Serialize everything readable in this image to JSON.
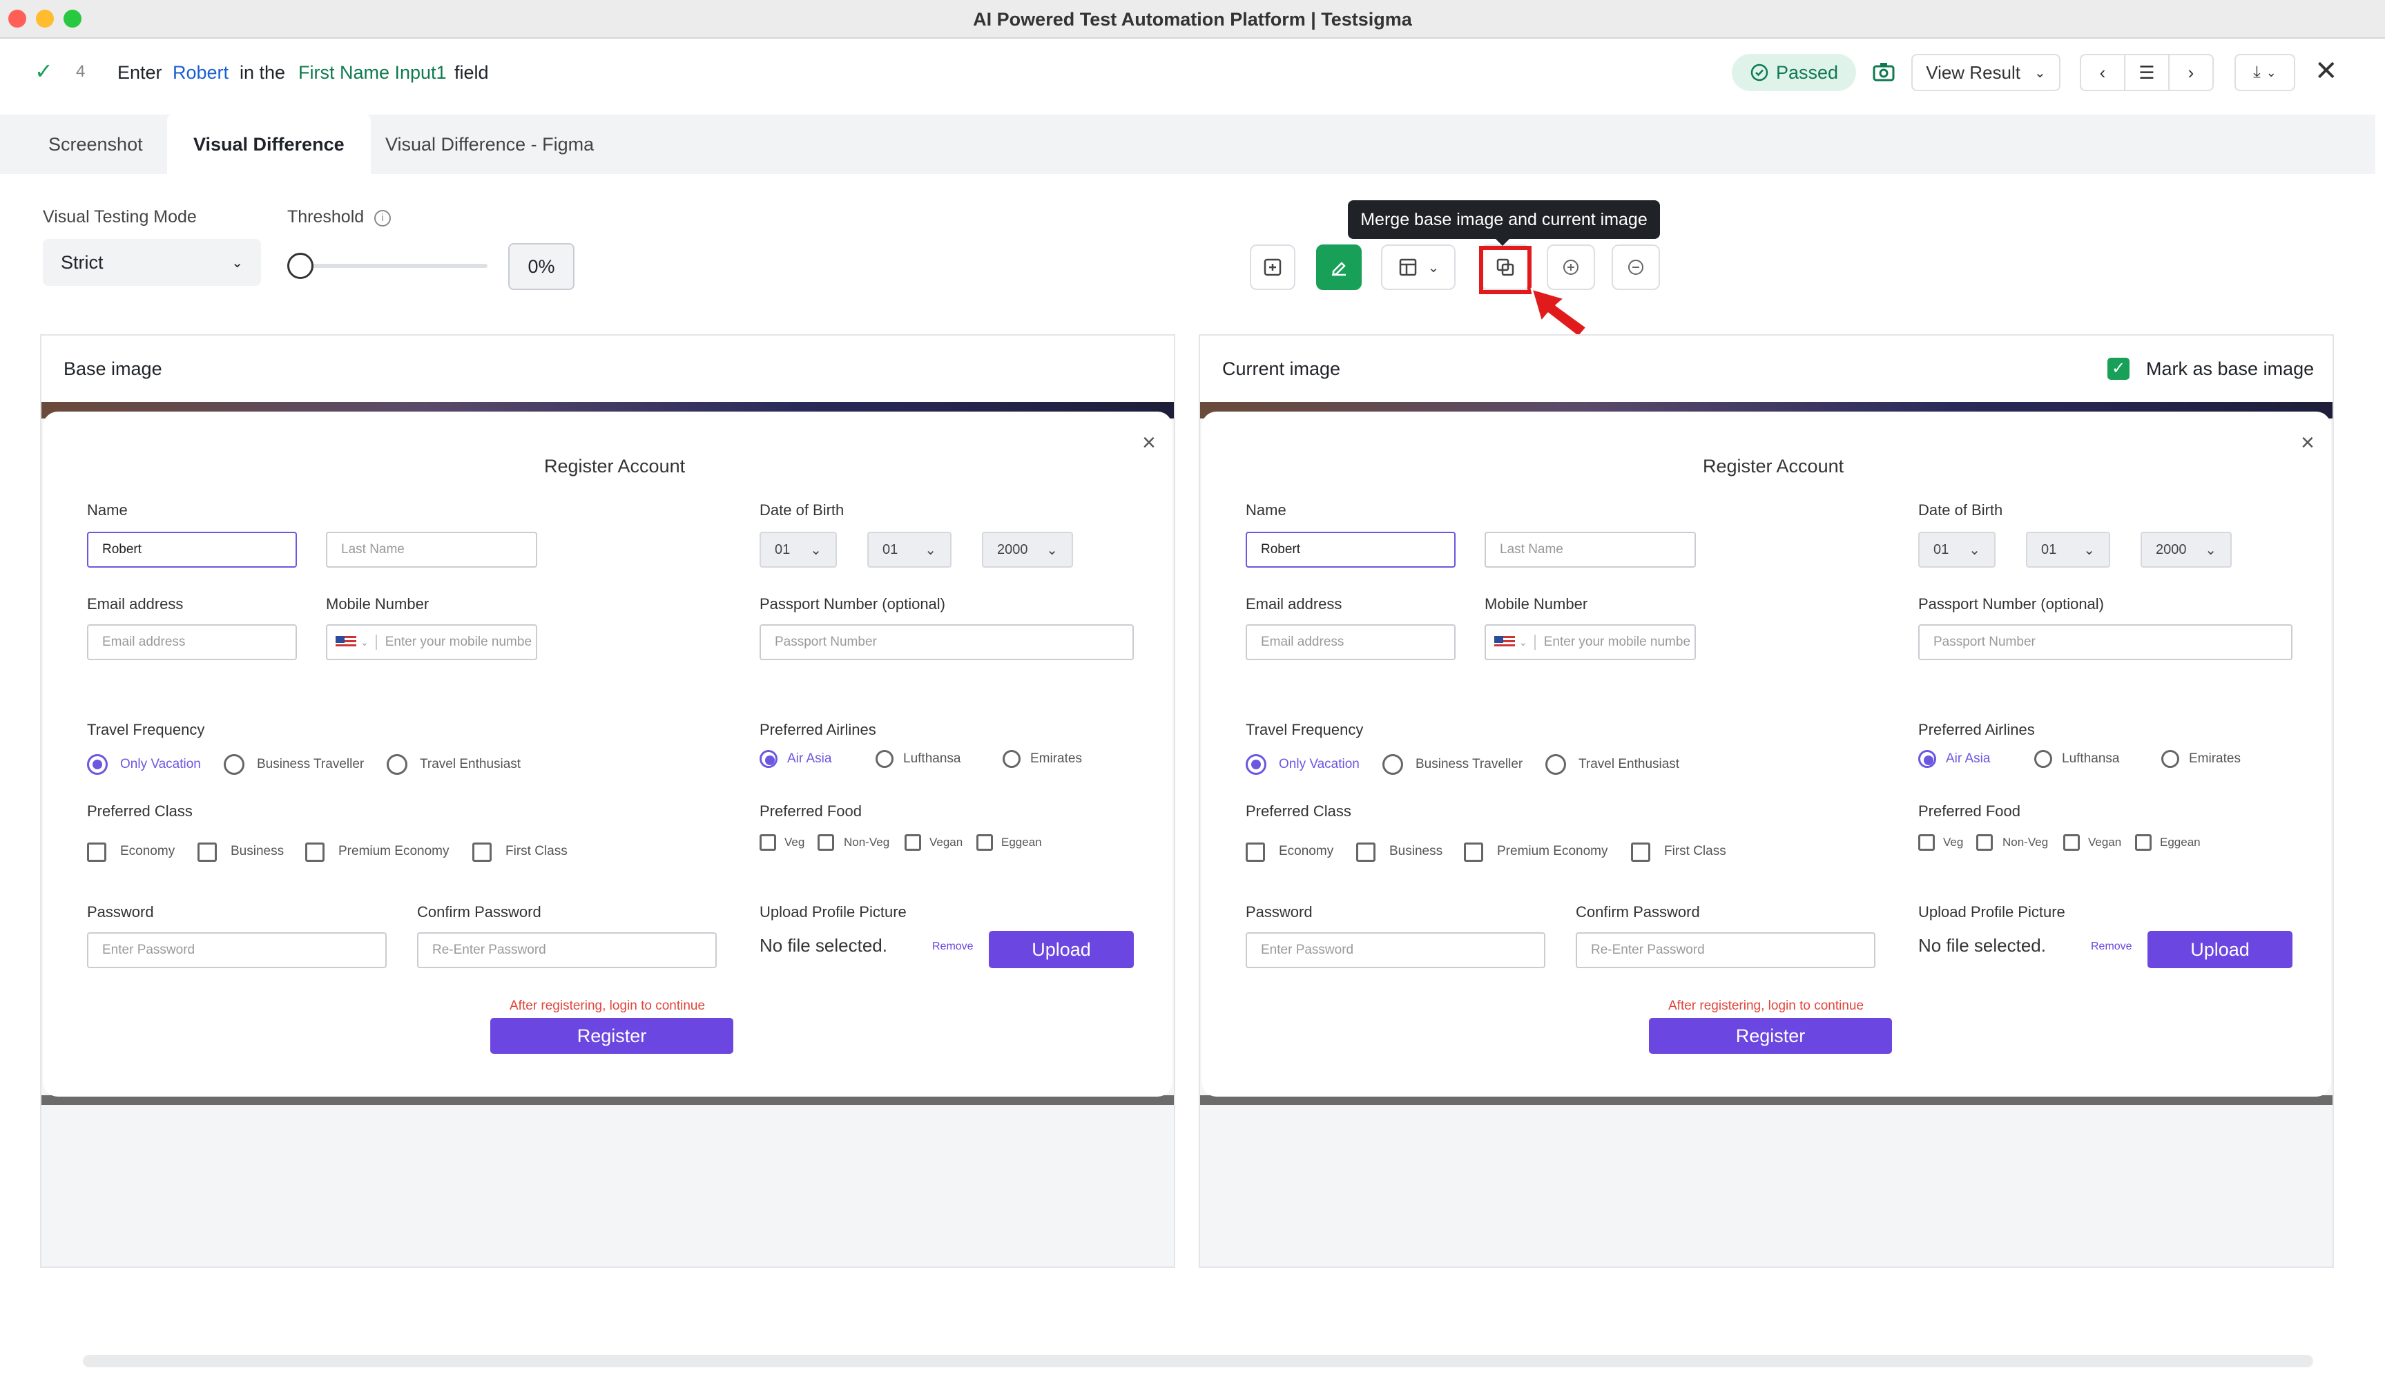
{
  "window": {
    "title": "AI Powered Test Automation Platform | Testsigma"
  },
  "step": {
    "number": "4",
    "parts": [
      "Enter",
      "Robert",
      "in the",
      "First Name Input1",
      "field"
    ],
    "status": "Passed",
    "view_result": "View Result"
  },
  "tabs": [
    "Screenshot",
    "Visual Difference",
    "Visual Difference - Figma"
  ],
  "controls": {
    "mode_label": "Visual Testing Mode",
    "mode_value": "Strict",
    "threshold_label": "Threshold",
    "threshold_value": "0%",
    "threshold_level": 0
  },
  "toolbar": {
    "tooltip": "Merge base image and current image"
  },
  "panels": {
    "base_title": "Base image",
    "current_title": "Current image",
    "mark_base": "Mark as base image"
  },
  "form": {
    "title": "Register Account",
    "name_label": "Name",
    "first_name_value": "Robert",
    "last_name_placeholder": "Last Name",
    "dob_label": "Date of Birth",
    "dob_day": "01",
    "dob_month": "01",
    "dob_year": "2000",
    "email_label": "Email address",
    "email_placeholder": "Email address",
    "mobile_label": "Mobile Number",
    "mobile_placeholder": "Enter your mobile numbe",
    "passport_label": "Passport Number (optional)",
    "passport_placeholder": "Passport Number",
    "travel_label": "Travel Frequency",
    "travel_options": [
      "Only Vacation",
      "Business Traveller",
      "Travel Enthusiast"
    ],
    "airlines_label": "Preferred Airlines",
    "airline_options": [
      "Air Asia",
      "Lufthansa",
      "Emirates"
    ],
    "class_label": "Preferred Class",
    "class_options": [
      "Economy",
      "Business",
      "Premium Economy",
      "First Class"
    ],
    "food_label": "Preferred Food",
    "food_options": [
      "Veg",
      "Non-Veg",
      "Vegan",
      "Eggean"
    ],
    "password_label": "Password",
    "password_placeholder": "Enter Password",
    "confirm_label": "Confirm Password",
    "confirm_placeholder": "Re-Enter Password",
    "upload_label": "Upload Profile Picture",
    "no_file": "No file selected.",
    "remove": "Remove",
    "upload_button": "Upload",
    "note": "After registering, login to continue",
    "register_button": "Register"
  },
  "colors": {
    "accent": "#6b46e0",
    "passed": "#0f7a4f",
    "highlight": "#e11b1b"
  }
}
